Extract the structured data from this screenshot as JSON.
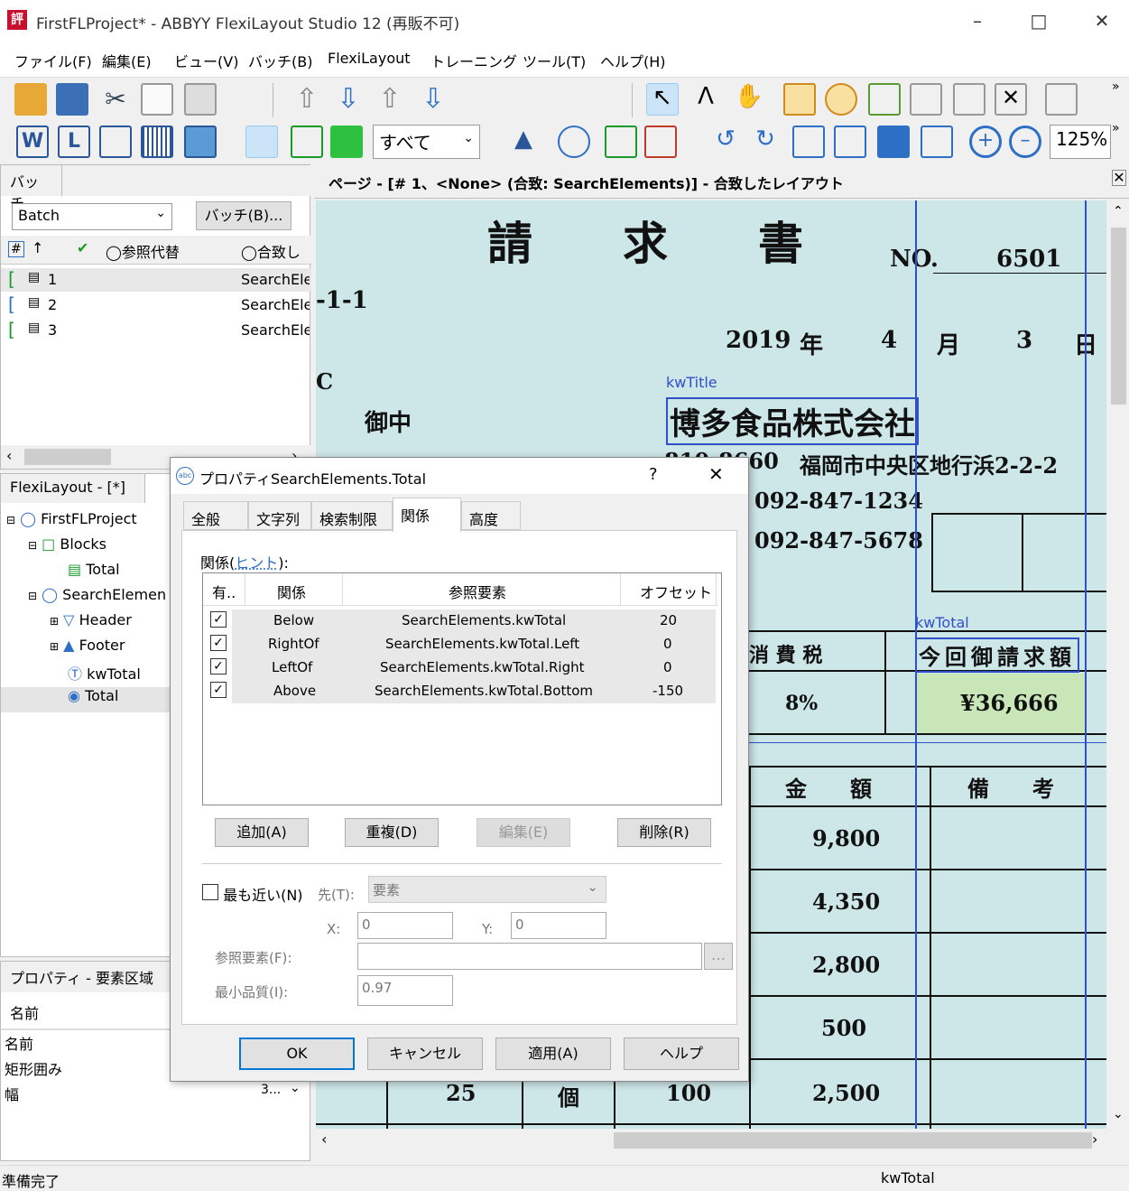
{
  "window": {
    "title": "FirstFLProject* - ABBYY FlexiLayout Studio 12 (再販不可)",
    "app_icon": "評"
  },
  "menu": [
    "ファイル(F)",
    "編集(E)",
    "ビュー(V)",
    "バッチ(B)",
    "FlexiLayout",
    "トレーニング",
    "ツール(T)",
    "ヘルプ(H)"
  ],
  "toolbar": {
    "filter": "すべて",
    "zoom": "125%"
  },
  "batch_panel": {
    "title": "バッチ",
    "combo": "Batch",
    "batch_button": "バッチ(B)...",
    "col_ref": "参照代替",
    "col_match": "合致し",
    "rows": [
      {
        "num": "1",
        "match": "SearchEle"
      },
      {
        "num": "2",
        "match": "SearchEle"
      },
      {
        "num": "3",
        "match": "SearchEle"
      }
    ]
  },
  "tree": {
    "title": "FlexiLayout - [*]",
    "items": [
      {
        "label": "FirstFLProject"
      },
      {
        "label": "Blocks"
      },
      {
        "label": "Total"
      },
      {
        "label": "SearchElemen"
      },
      {
        "label": "Header"
      },
      {
        "label": "Footer"
      },
      {
        "label": "kwTotal"
      },
      {
        "label": "Total"
      }
    ]
  },
  "props_panel": {
    "title": "プロパティ - 要素区域",
    "header": "名前",
    "rows": [
      {
        "name": "名前",
        "value": ""
      },
      {
        "name": "矩形囲み",
        "value": ""
      },
      {
        "name": "幅",
        "value": "3..."
      }
    ]
  },
  "page_header": "ページ - [# 1、<None> (合致: SearchElements)] - 合致したレイアウト",
  "document": {
    "title": "請　　求　　書",
    "no_label": "NO.",
    "no_value": "6501",
    "addr_frag": "-1-1",
    "year": "2019",
    "year_u": "年",
    "month": "4",
    "month_u": "月",
    "day": "3",
    "day_u": "日",
    "c_frag": "C",
    "kwtitle_label": "kwTitle",
    "company": "博多食品株式会社",
    "onchu": "御中",
    "postal": "810-8660",
    "address": "福岡市中央区地行浜2-2-2",
    "tel": "092-847-1234",
    "fax": "092-847-5678",
    "kwtotal_label": "kwTotal",
    "tax_label": "消 費 税",
    "total_label": "今回御請求額",
    "tax_rate": "8%",
    "total_amount": "¥36,666",
    "amount_header": "金　　額",
    "note_header": "備　　考",
    "amounts": [
      "9,800",
      "4,350",
      "2,800",
      "500",
      "2,500"
    ],
    "last_row": {
      "qty": "25",
      "unit": "個",
      "price": "100"
    }
  },
  "dialog": {
    "title": "プロパティSearchElements.Total",
    "help": "?",
    "tabs": [
      "全般",
      "文字列",
      "検索制限",
      "関係",
      "高度"
    ],
    "active_tab": "関係",
    "relations_label": "関係(",
    "hint": "ヒント",
    "relations_label_end": "):",
    "columns": [
      "有..",
      "関係",
      "参照要素",
      "オフセット"
    ],
    "relations": [
      {
        "rel": "Below",
        "ref": "SearchElements.kwTotal",
        "offset": "20"
      },
      {
        "rel": "RightOf",
        "ref": "SearchElements.kwTotal.Left",
        "offset": "0"
      },
      {
        "rel": "LeftOf",
        "ref": "SearchElements.kwTotal.Right",
        "offset": "0"
      },
      {
        "rel": "Above",
        "ref": "SearchElements.kwTotal.Bottom",
        "offset": "-150"
      }
    ],
    "add": "追加(A)",
    "dup": "重複(D)",
    "edit": "編集(E)",
    "del": "削除(R)",
    "nearest": "最も近い(N)",
    "dest_label": "先(T):",
    "dest_value": "要素",
    "x_label": "X:",
    "x_value": "0",
    "y_label": "Y:",
    "y_value": "0",
    "ref_label": "参照要素(F):",
    "ref_value": "",
    "minq_label": "最小品質(I):",
    "minq_value": "0.97",
    "ok": "OK",
    "cancel": "キャンセル",
    "apply": "適用(A)",
    "helpbtn": "ヘルプ"
  },
  "status": {
    "left": "準備完了",
    "right": "kwTotal"
  }
}
